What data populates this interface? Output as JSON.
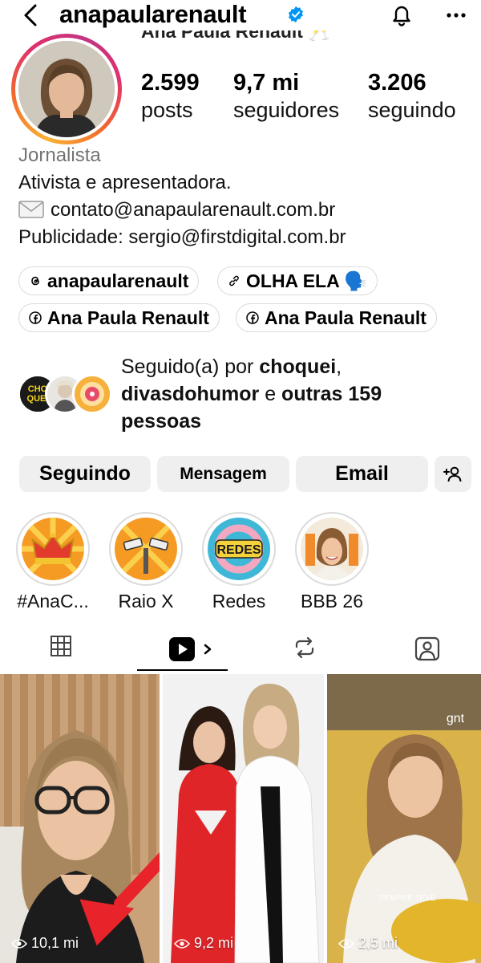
{
  "header": {
    "username": "anapaularenault"
  },
  "profile": {
    "full_name": "Ana Paula Renault 🥂",
    "stats": [
      {
        "value": "2.599",
        "label": "posts"
      },
      {
        "value": "9,7 mi",
        "label": "seguidores"
      },
      {
        "value": "3.206",
        "label": "seguindo"
      }
    ],
    "category": "Jornalista",
    "bio_lines": [
      "Ativista e apresentadora.",
      "contato@anapaularenault.com.br",
      "Publicidade: sergio@firstdigital.com.br"
    ]
  },
  "links": [
    {
      "label": "anapaularenault",
      "icon": "threads-icon"
    },
    {
      "label": "OLHA ELA 🗣️",
      "icon": "link-icon"
    },
    {
      "label": "Ana Paula Renault",
      "icon": "facebook-icon"
    },
    {
      "label": "Ana Paula Renault",
      "icon": "facebook-icon"
    }
  ],
  "followed_by": {
    "prefix": "Seguido(a) por ",
    "name1": "choquei",
    "sep": ",",
    "name2": "divasdohumor",
    "middle": " e ",
    "others": "outras 159 pessoas",
    "avatar1_text": "CHO\nQUEI"
  },
  "buttons": {
    "following": "Seguindo",
    "message": "Mensagem",
    "email": "Email"
  },
  "highlights": [
    {
      "label": "#AnaC..."
    },
    {
      "label": "Raio X"
    },
    {
      "label": "Redes",
      "cover_text": "REDES"
    },
    {
      "label": "BBB 26"
    }
  ],
  "grid": [
    {
      "views": "10,1 mi"
    },
    {
      "views": "9,2 mi"
    },
    {
      "views": "2,5 mi",
      "watermark": "gnt",
      "caption": "SEMPRE TEVE"
    }
  ],
  "colors": {
    "verified": "#0095f6",
    "button_bg": "#efefef",
    "muted": "#737373",
    "annotation_arrow": "#e8232a"
  }
}
